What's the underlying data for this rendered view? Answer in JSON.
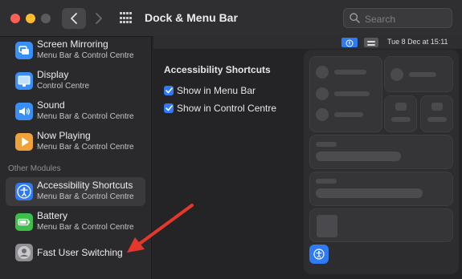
{
  "window": {
    "title": "Dock & Menu Bar",
    "search_placeholder": "Search"
  },
  "sidebar": {
    "items_top": [
      {
        "name": "Screen Mirroring",
        "sub": "Menu Bar & Control Centre",
        "icon": "screen-mirroring-icon",
        "color": "#3a8ff7"
      },
      {
        "name": "Display",
        "sub": "Control Centre",
        "icon": "display-icon",
        "color": "#3a8ff7"
      },
      {
        "name": "Sound",
        "sub": "Menu Bar & Control Centre",
        "icon": "sound-icon",
        "color": "#3a8ff7"
      },
      {
        "name": "Now Playing",
        "sub": "Menu Bar & Control Centre",
        "icon": "now-playing-icon",
        "color": "#f0a23a"
      }
    ],
    "section_title": "Other Modules",
    "items_other": [
      {
        "name": "Accessibility Shortcuts",
        "sub": "Menu Bar & Control Centre",
        "icon": "accessibility-icon",
        "color": "#2f7bf5",
        "selected": true
      },
      {
        "name": "Battery",
        "sub": "Menu Bar & Control Centre",
        "icon": "battery-icon",
        "color": "#3cbf4a"
      },
      {
        "name": "Fast User Switching",
        "sub": "",
        "icon": "user-icon",
        "color": "#8e8e93"
      }
    ]
  },
  "menubar": {
    "datetime": "Tue 8 Dec at  15:11"
  },
  "main": {
    "section_title": "Accessibility Shortcuts",
    "options": [
      {
        "label": "Show in Menu Bar",
        "checked": true
      },
      {
        "label": "Show in Control Centre",
        "checked": true
      }
    ]
  },
  "colors": {
    "accent": "#2f7bf5",
    "annotation_arrow": "#e5372b"
  }
}
